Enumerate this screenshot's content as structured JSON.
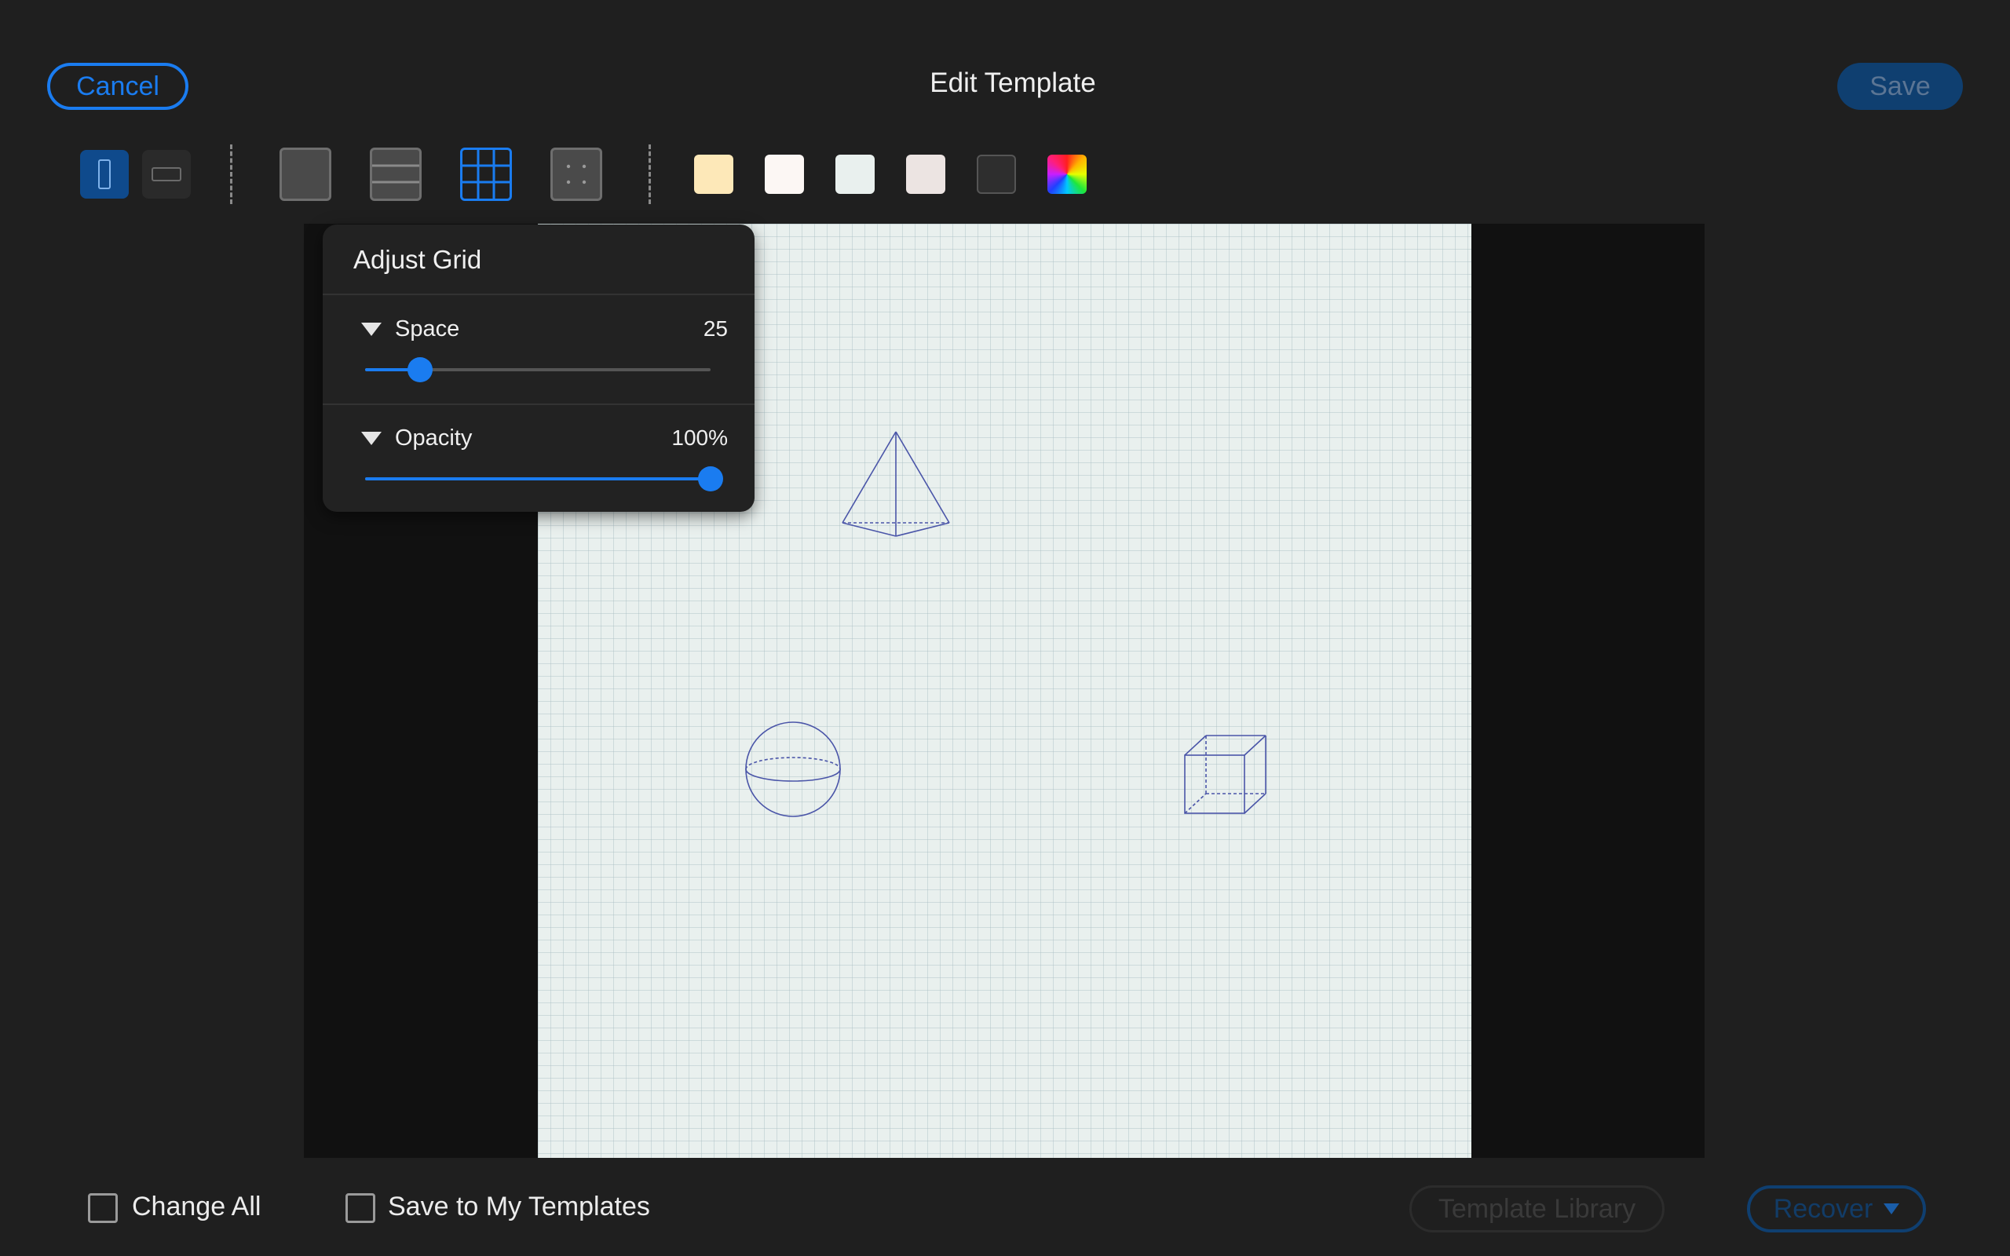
{
  "header": {
    "cancel_label": "Cancel",
    "title": "Edit Template",
    "save_label": "Save"
  },
  "toolbar": {
    "orientations": [
      {
        "name": "portrait",
        "selected": true
      },
      {
        "name": "landscape",
        "selected": false
      }
    ],
    "styles": [
      {
        "name": "blank",
        "selected": false
      },
      {
        "name": "lined",
        "selected": false
      },
      {
        "name": "grid",
        "selected": true
      },
      {
        "name": "dots",
        "selected": false
      }
    ],
    "colors": [
      "#fde8b8",
      "#fcf7f4",
      "#e9f0ee",
      "#ece4e2",
      "#2e2e2e",
      "rainbow"
    ]
  },
  "panel": {
    "title": "Adjust Grid",
    "space": {
      "label": "Space",
      "value": "25",
      "fraction": 0.16
    },
    "opacity": {
      "label": "Opacity",
      "value": "100%",
      "fraction": 1.0
    }
  },
  "canvas": {
    "paper_color": "#e9f0ee",
    "shapes": [
      "pyramid",
      "sphere",
      "cube"
    ]
  },
  "footer": {
    "change_all_label": "Change All",
    "save_to_templates_label": "Save to My Templates",
    "library_label": "Template Library",
    "recover_label": "Recover"
  }
}
